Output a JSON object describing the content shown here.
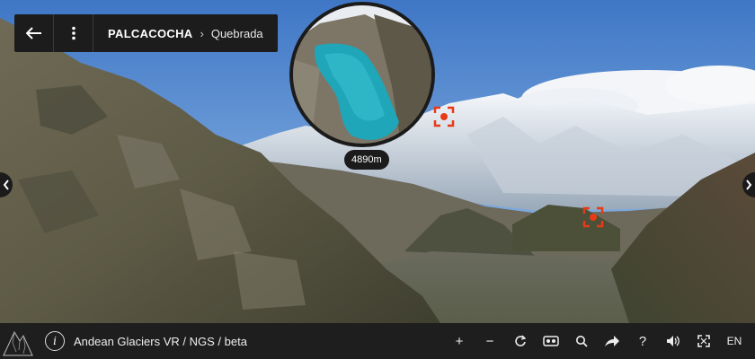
{
  "nav": {
    "back_icon": "arrow-left-icon",
    "menu_icon": "vertical-dots-icon",
    "location": "PALCACOCHA",
    "separator": "›",
    "sublocation": "Quebrada"
  },
  "preview": {
    "altitude": "4890m"
  },
  "hotspots": [
    {
      "name": "hotspot-upper",
      "icon": "target-icon"
    },
    {
      "name": "hotspot-lower",
      "icon": "target-icon"
    }
  ],
  "bottombar": {
    "info_symbol": "i",
    "title": "Andean Glaciers VR / NGS / beta",
    "tools": {
      "zoom_in": "+",
      "zoom_out": "−",
      "help": "?",
      "language": "EN"
    }
  },
  "colors": {
    "bar": "#1e1e1e",
    "hotspot": "#e83a16",
    "lake": "#1fa6b8",
    "sky": "#4f86cf"
  }
}
